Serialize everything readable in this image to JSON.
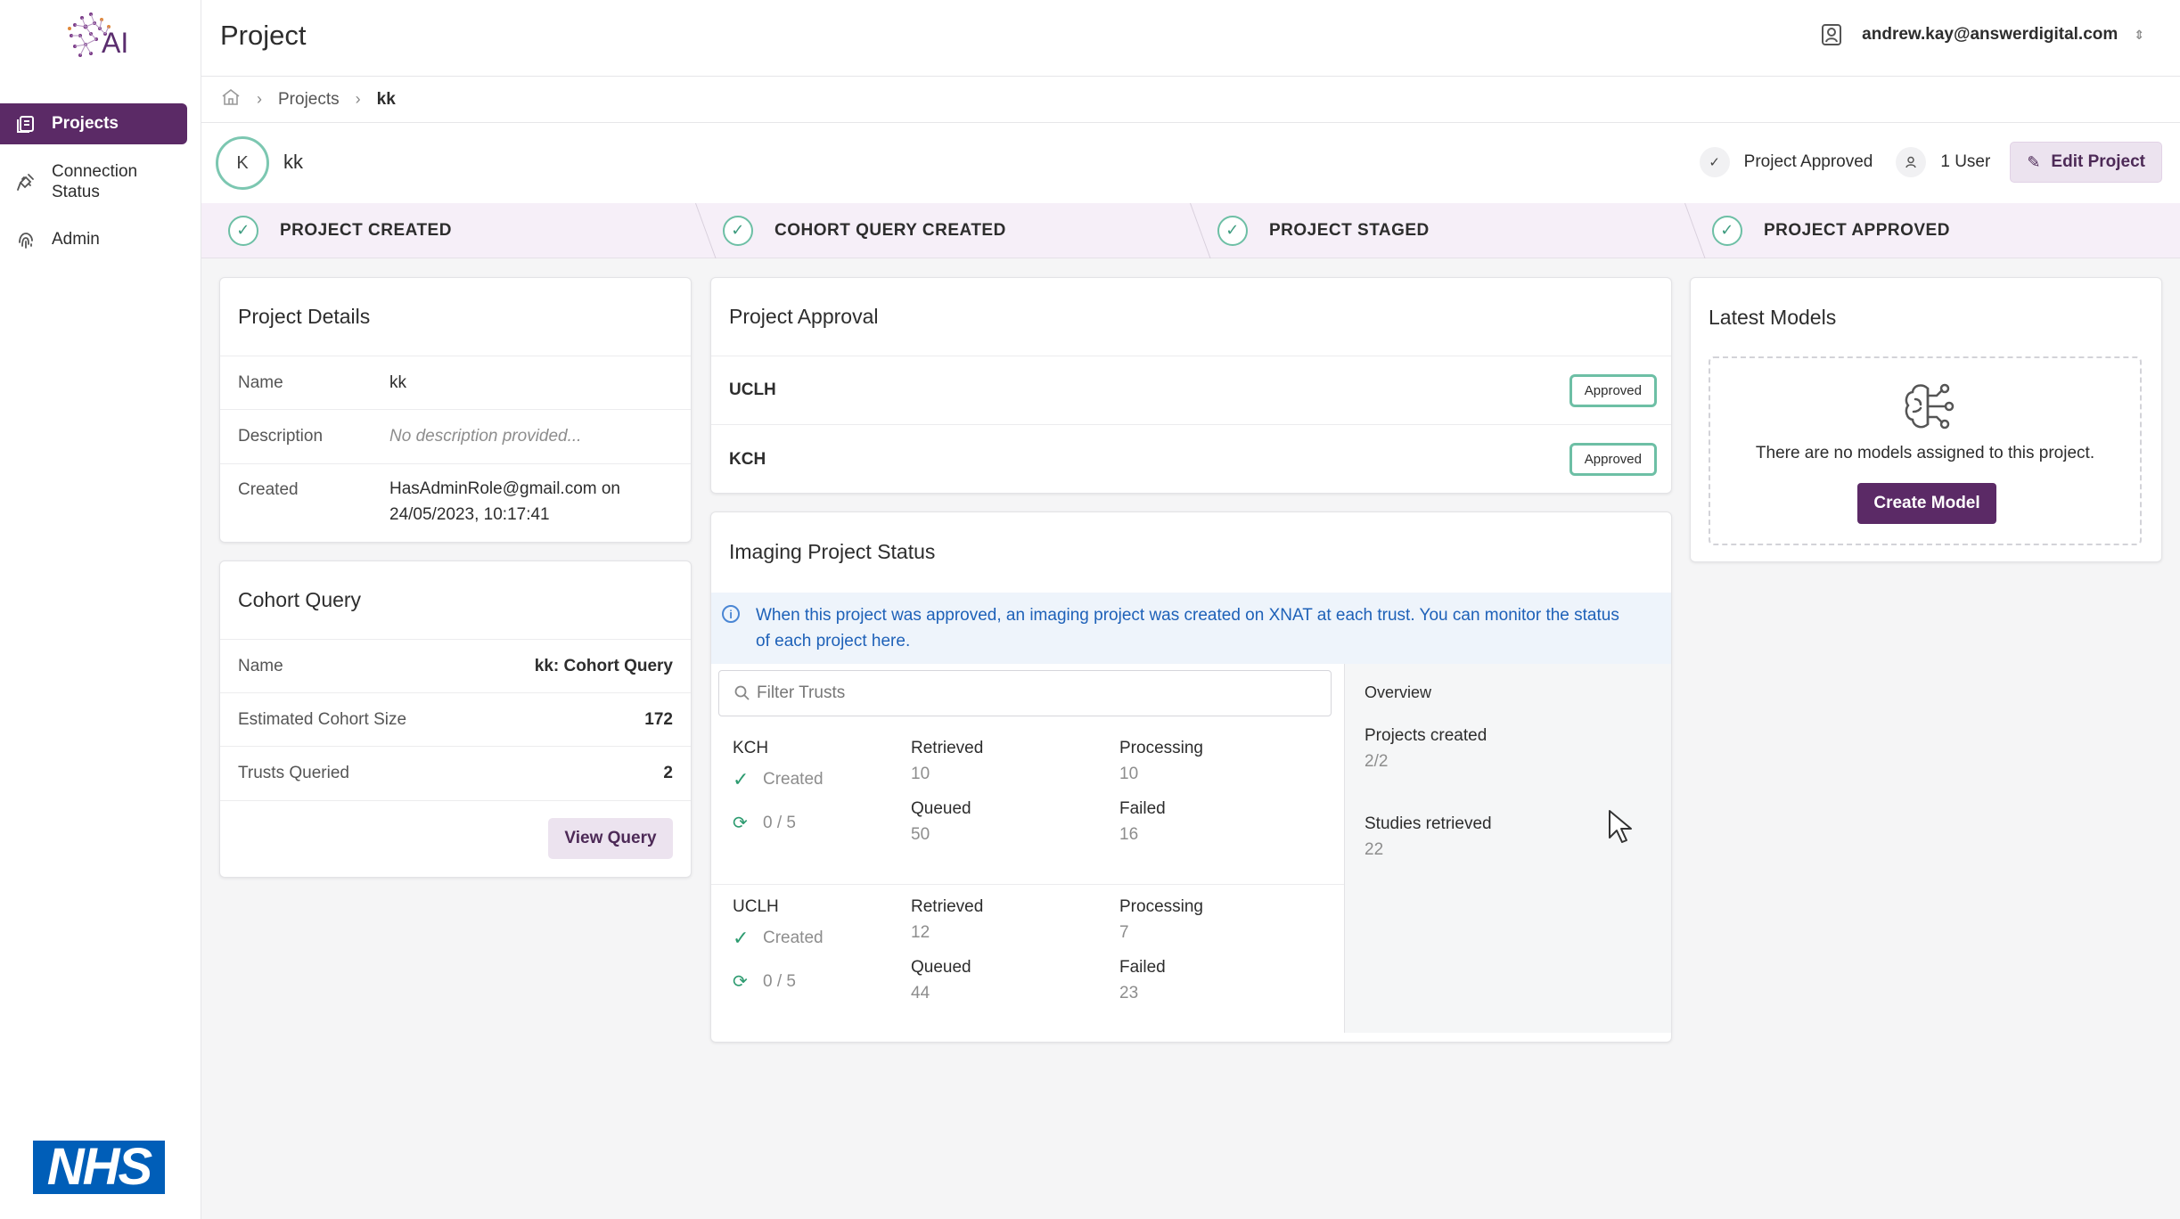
{
  "sidebar": {
    "logo_text": "AI",
    "items": [
      {
        "label": "Projects",
        "icon": "document-list-icon",
        "active": true
      },
      {
        "label": "Connection Status",
        "label_line1": "Connection",
        "label_line2": "Status",
        "icon": "plug-icon"
      },
      {
        "label": "Admin",
        "icon": "fingerprint-icon"
      }
    ],
    "footer_logo": "NHS"
  },
  "header": {
    "title": "Project",
    "user_email": "andrew.kay@answerdigital.com",
    "user_icon": "user-badge-icon"
  },
  "breadcrumb": {
    "home_icon": "home-icon",
    "items": [
      "Projects",
      "kk"
    ]
  },
  "project": {
    "avatar_letter": "K",
    "name": "kk",
    "status": "Project Approved",
    "users": "1 User",
    "edit_label": "Edit Project"
  },
  "steps": [
    "PROJECT CREATED",
    "COHORT QUERY CREATED",
    "PROJECT STAGED",
    "PROJECT APPROVED"
  ],
  "project_details": {
    "title": "Project Details",
    "rows": [
      {
        "label": "Name",
        "value": "kk"
      },
      {
        "label": "Description",
        "value": "No description provided..."
      },
      {
        "label": "Created",
        "value_line1": "HasAdminRole@gmail.com on",
        "value_line2": "24/05/2023, 10:17:41"
      }
    ]
  },
  "cohort_query": {
    "title": "Cohort Query",
    "rows": [
      {
        "label": "Name",
        "value": "kk: Cohort Query"
      },
      {
        "label": "Estimated Cohort Size",
        "value": "172"
      },
      {
        "label": "Trusts Queried",
        "value": "2"
      }
    ],
    "button": "View Query"
  },
  "project_approval": {
    "title": "Project Approval",
    "rows": [
      {
        "trust": "UCLH",
        "status": "Approved"
      },
      {
        "trust": "KCH",
        "status": "Approved"
      }
    ]
  },
  "imaging_status": {
    "title": "Imaging Project Status",
    "info": "When this project was approved, an imaging project was created on XNAT at each trust. You can monitor the status of each project here.",
    "filter_placeholder": "Filter Trusts",
    "trusts": [
      {
        "name": "KCH",
        "status": "Created",
        "progress": "0 / 5",
        "retrieved_label": "Retrieved",
        "retrieved": "10",
        "processing_label": "Processing",
        "processing": "10",
        "queued_label": "Queued",
        "queued": "50",
        "failed_label": "Failed",
        "failed": "16"
      },
      {
        "name": "UCLH",
        "status": "Created",
        "progress": "0 / 5",
        "retrieved_label": "Retrieved",
        "retrieved": "12",
        "processing_label": "Processing",
        "processing": "7",
        "queued_label": "Queued",
        "queued": "44",
        "failed_label": "Failed",
        "failed": "23"
      }
    ],
    "overview": {
      "title": "Overview",
      "projects_created_label": "Projects created",
      "projects_created": "2/2",
      "studies_retrieved_label": "Studies retrieved",
      "studies_retrieved": "22"
    }
  },
  "latest_models": {
    "title": "Latest Models",
    "empty_text": "There are no models assigned to this project.",
    "button": "Create Model",
    "icon": "brain-circuit-icon"
  },
  "colors": {
    "brand": "#5b2a66",
    "accent_soft": "#ece3ef",
    "success": "#6dbfa5",
    "info": "#1e61b8",
    "nhs": "#005eb8"
  }
}
